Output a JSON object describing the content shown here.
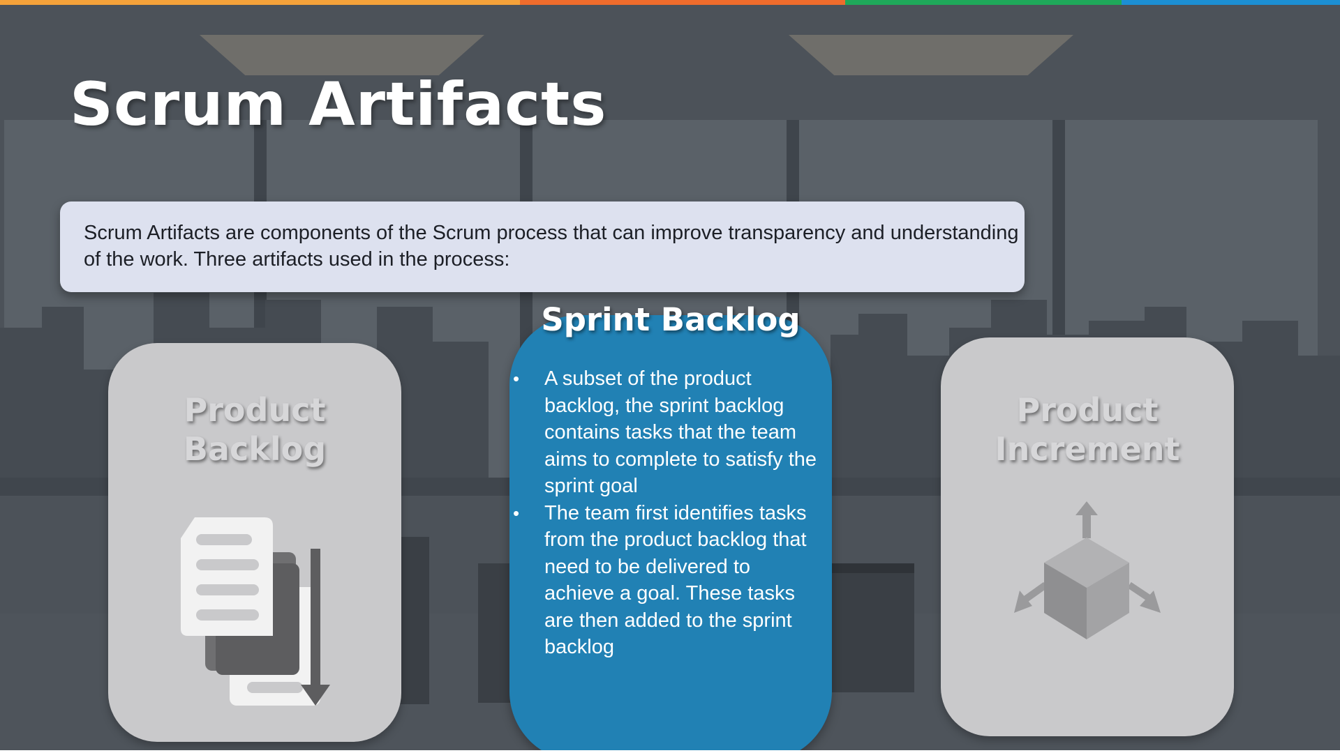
{
  "slide": {
    "title": "Scrum Artifacts",
    "intro": "Scrum Artifacts are components of the Scrum process that can improve transparency and understanding of the work. Three artifacts used in the process:"
  },
  "artifacts": [
    {
      "title_lines": [
        "Product",
        "Backlog"
      ],
      "icon": "documents-icon",
      "state": "dimmed"
    },
    {
      "title": "Sprint Backlog",
      "state": "active",
      "bullets": [
        "A subset of the product backlog, the sprint backlog contains tasks that the team aims to complete to satisfy the sprint goal",
        "The team first identifies tasks from the product backlog that need to be delivered to achieve a goal. These tasks are then added to the sprint backlog"
      ]
    },
    {
      "title_lines": [
        "Product",
        "Increment"
      ],
      "icon": "cube-axes-icon",
      "state": "dimmed"
    }
  ],
  "colors": {
    "top_strip": [
      "#f5a23a",
      "#ef6c2c",
      "#1fa85a",
      "#1c8fd3"
    ],
    "active_card": "#2181b4",
    "dimmed_card": "#c9c9cb",
    "intro_box": "#dde1ef"
  }
}
